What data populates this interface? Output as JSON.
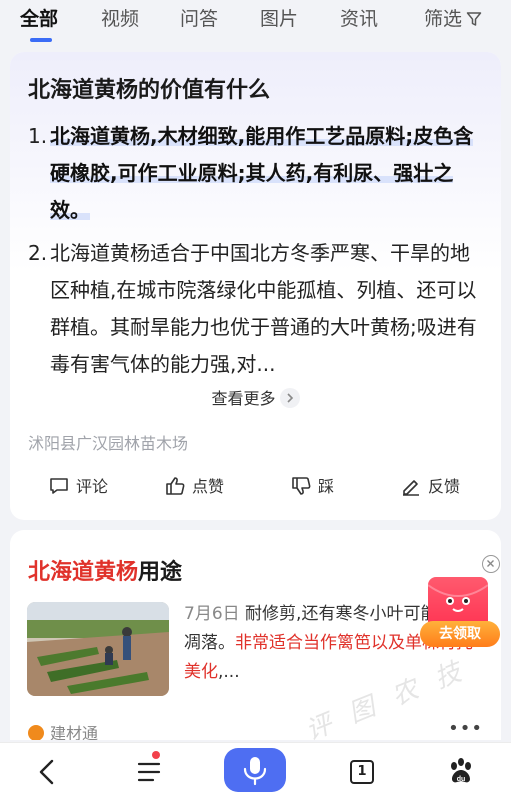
{
  "tabs": [
    {
      "label": "全部",
      "active": true
    },
    {
      "label": "视频"
    },
    {
      "label": "问答"
    },
    {
      "label": "图片"
    },
    {
      "label": "资讯"
    },
    {
      "label": "筛选"
    }
  ],
  "card1": {
    "question": "北海道黄杨的价值有什么",
    "answers": [
      {
        "num": "1.",
        "text": "北海道黄杨,木材细致,能用作工艺品原料;皮色含硬橡胶,可作工业原料;其人药,有利尿、强壮之效。"
      },
      {
        "num": "2.",
        "text": "北海道黄杨适合于中国北方冬季严寒、干旱的地区种植,在城市院落绿化中能孤植、列植、还可以群植。其耐旱能力也优于普通的大叶黄杨;吸进有毒有害气体的能力强,对..."
      }
    ],
    "see_more": "查看更多",
    "source": "沭阳县广汉园林苗木场",
    "actions": {
      "comment": "评论",
      "like": "点赞",
      "dislike": "踩",
      "feedback": "反馈"
    }
  },
  "card2": {
    "title_highlight": "北海道黄杨",
    "title_rest": "用途",
    "date": "7月6日",
    "snippet_plain": "耐修剪,还有寒冬小叶可能产生凋落。",
    "snippet_red": "非常适合当作篱笆以及单株衬托美化",
    "snippet_tail": ",...",
    "source": "建材通",
    "more": "•••"
  },
  "promo": {
    "label": "去领取"
  },
  "watermark": "评 图 农 技",
  "bottom_nav": {
    "tab_count": "1"
  },
  "colors": {
    "accent": "#3b6cf6",
    "mic": "#4e6ef2",
    "highlight_red": "#e0322b",
    "promo_red": "#ff3352",
    "promo_orange": "#ff7d1a"
  }
}
